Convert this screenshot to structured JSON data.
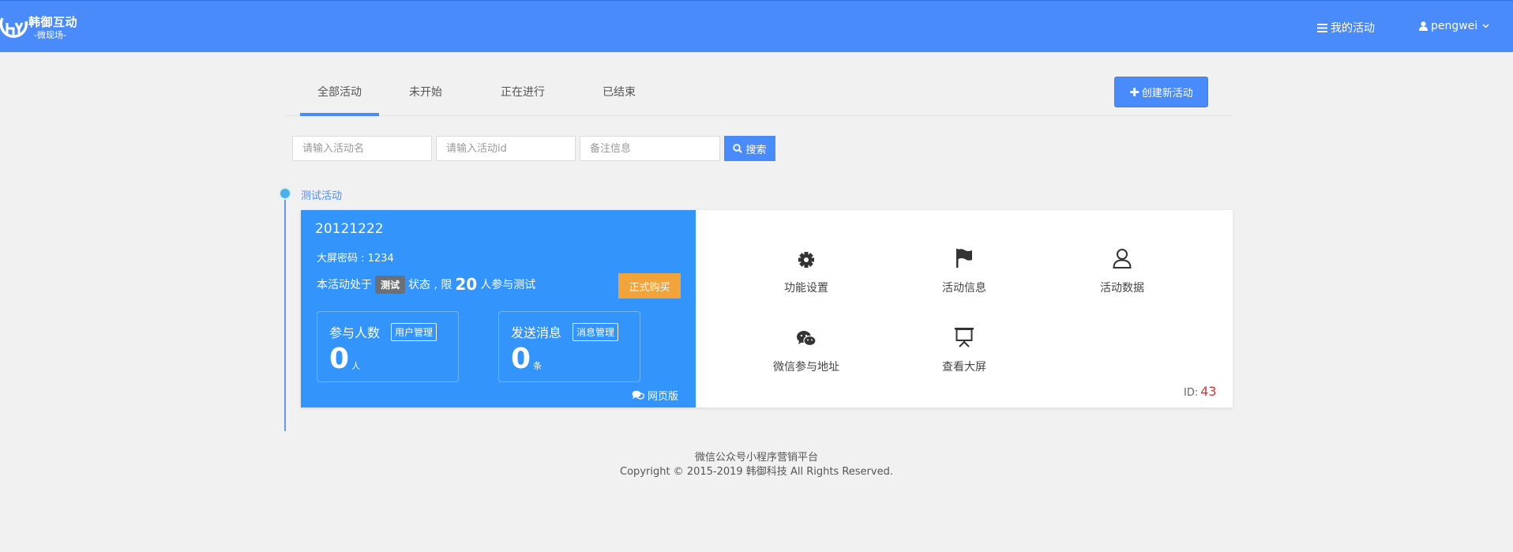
{
  "brand": {
    "title": "韩御互动",
    "subtitle": "-微现场-"
  },
  "nav": {
    "my_activities": "我的活动",
    "username": "pengwei"
  },
  "tabs": [
    {
      "label": "全部活动",
      "active": true
    },
    {
      "label": "未开始",
      "active": false
    },
    {
      "label": "正在进行",
      "active": false
    },
    {
      "label": "已结束",
      "active": false
    }
  ],
  "create_button": "创建新活动",
  "search": {
    "name_placeholder": "请输入活动名",
    "id_placeholder": "请输入活动id",
    "note_placeholder": "备注信息",
    "button": "搜索"
  },
  "group_label": "测试活动",
  "activity": {
    "name": "20121222",
    "password_text": "大屏密码 : 1234",
    "status_prefix": "本活动处于",
    "status_badge": "测试",
    "status_mid": "状态 , 限",
    "limit": "20",
    "status_suffix": "人参与测试",
    "buy_button": "正式购买",
    "participants": {
      "title": "参与人数",
      "manage": "用户管理",
      "value": "0",
      "unit": "人"
    },
    "messages": {
      "title": "发送消息",
      "manage": "消息管理",
      "value": "0",
      "unit": "条"
    },
    "web_version": "网页版",
    "functions": [
      {
        "icon": "gear-icon",
        "label": "功能设置"
      },
      {
        "icon": "flag-icon",
        "label": "活动信息"
      },
      {
        "icon": "user-icon",
        "label": "活动数据"
      },
      {
        "icon": "wechat-icon",
        "label": "微信参与地址"
      },
      {
        "icon": "screen-icon",
        "label": "查看大屏"
      }
    ],
    "id_label": "ID:",
    "id_value": "43"
  },
  "footer": {
    "line1": "微信公众号小程序营销平台",
    "line2": "Copyright © 2015-2019 韩御科技 All Rights Reserved."
  },
  "colors": {
    "primary": "#4a8bfc",
    "card_blue": "#3394fb",
    "buy": "#f2a43b",
    "id_red": "#e03232"
  }
}
